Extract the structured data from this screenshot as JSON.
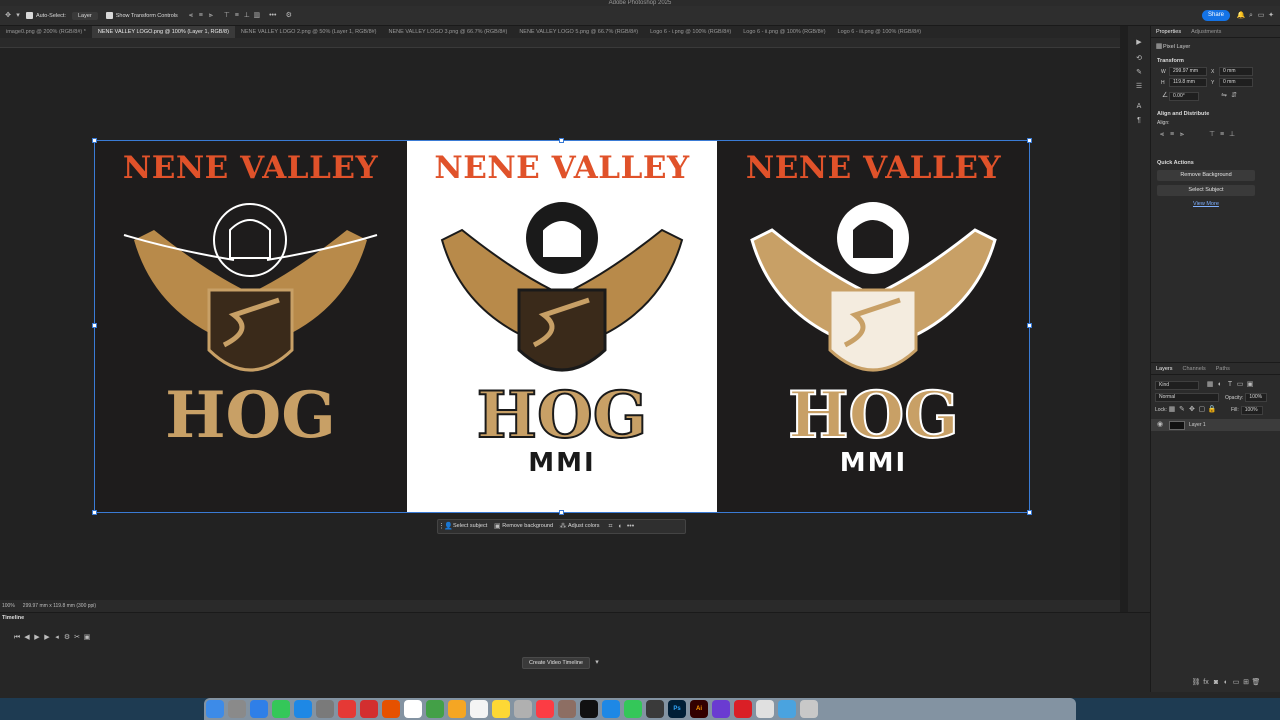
{
  "app": {
    "title": "Adobe Photoshop 2025"
  },
  "options_bar": {
    "auto_select_label": "Auto-Select:",
    "auto_select_value": "Layer",
    "transform_label": "Show Transform Controls",
    "share_label": "Share"
  },
  "tabs": [
    {
      "label": "image0.png @ 200% (RGB/8#) *"
    },
    {
      "label": "NENE VALLEY LOGO.png @ 100% (Layer 1, RGB/8)"
    },
    {
      "label": "NENE VALLEY LOGO 2.png @ 50% (Layer 1, RGB/8#)"
    },
    {
      "label": "NENE VALLEY LOGO 3.png @ 66.7% (RGB/8#)"
    },
    {
      "label": "NENE VALLEY LOGO 5.png @ 66.7% (RGB/8#)"
    },
    {
      "label": "Logo 6 - i.png @ 100% (RGB/8#)"
    },
    {
      "label": "Logo 6 - ii.png @ 100% (RGB/8#)"
    },
    {
      "label": "Logo 6 - iii.png @ 100% (RGB/8#)"
    }
  ],
  "logos": [
    {
      "title": "NENE VALLEY",
      "hog": "HOG",
      "mmi": ""
    },
    {
      "title": "NENE VALLEY",
      "hog": "HOG",
      "mmi": "MMI"
    },
    {
      "title": "NENE VALLEY",
      "hog": "HOG",
      "mmi": "MMI"
    }
  ],
  "context_bar": {
    "select_subject": "Select subject",
    "remove_background": "Remove background",
    "adjust_colors": "Adjust colors"
  },
  "status": {
    "zoom": "100%",
    "info": "299.97 mm x 119.8 mm (300 ppi)"
  },
  "timeline": {
    "title": "Timeline",
    "create_button": "Create Video Timeline"
  },
  "properties": {
    "tabs": [
      "Properties",
      "Adjustments"
    ],
    "layer_type": "Pixel Layer",
    "transform_title": "Transform",
    "w_label": "W",
    "w_value": "299.97 mm",
    "h_label": "H",
    "h_value": "119.8 mm",
    "x_label": "X",
    "x_value": "0 mm",
    "y_label": "Y",
    "y_value": "0 mm",
    "angle_value": "0.00°",
    "align_title": "Align and Distribute",
    "align_label": "Align:",
    "quick_actions_title": "Quick Actions",
    "remove_bg": "Remove Background",
    "select_subject": "Select Subject",
    "view_more": "View More"
  },
  "layers": {
    "tabs": [
      "Layers",
      "Channels",
      "Paths"
    ],
    "kind": "Kind",
    "blend": "Normal",
    "opacity_label": "Opacity:",
    "opacity_value": "100%",
    "lock_label": "Lock:",
    "fill_label": "Fill:",
    "fill_value": "100%",
    "layer_name": "Layer 1"
  },
  "colors": {
    "accent": "#1473e6",
    "logo_orange": "#e0522a",
    "gold": "#c8a066"
  }
}
